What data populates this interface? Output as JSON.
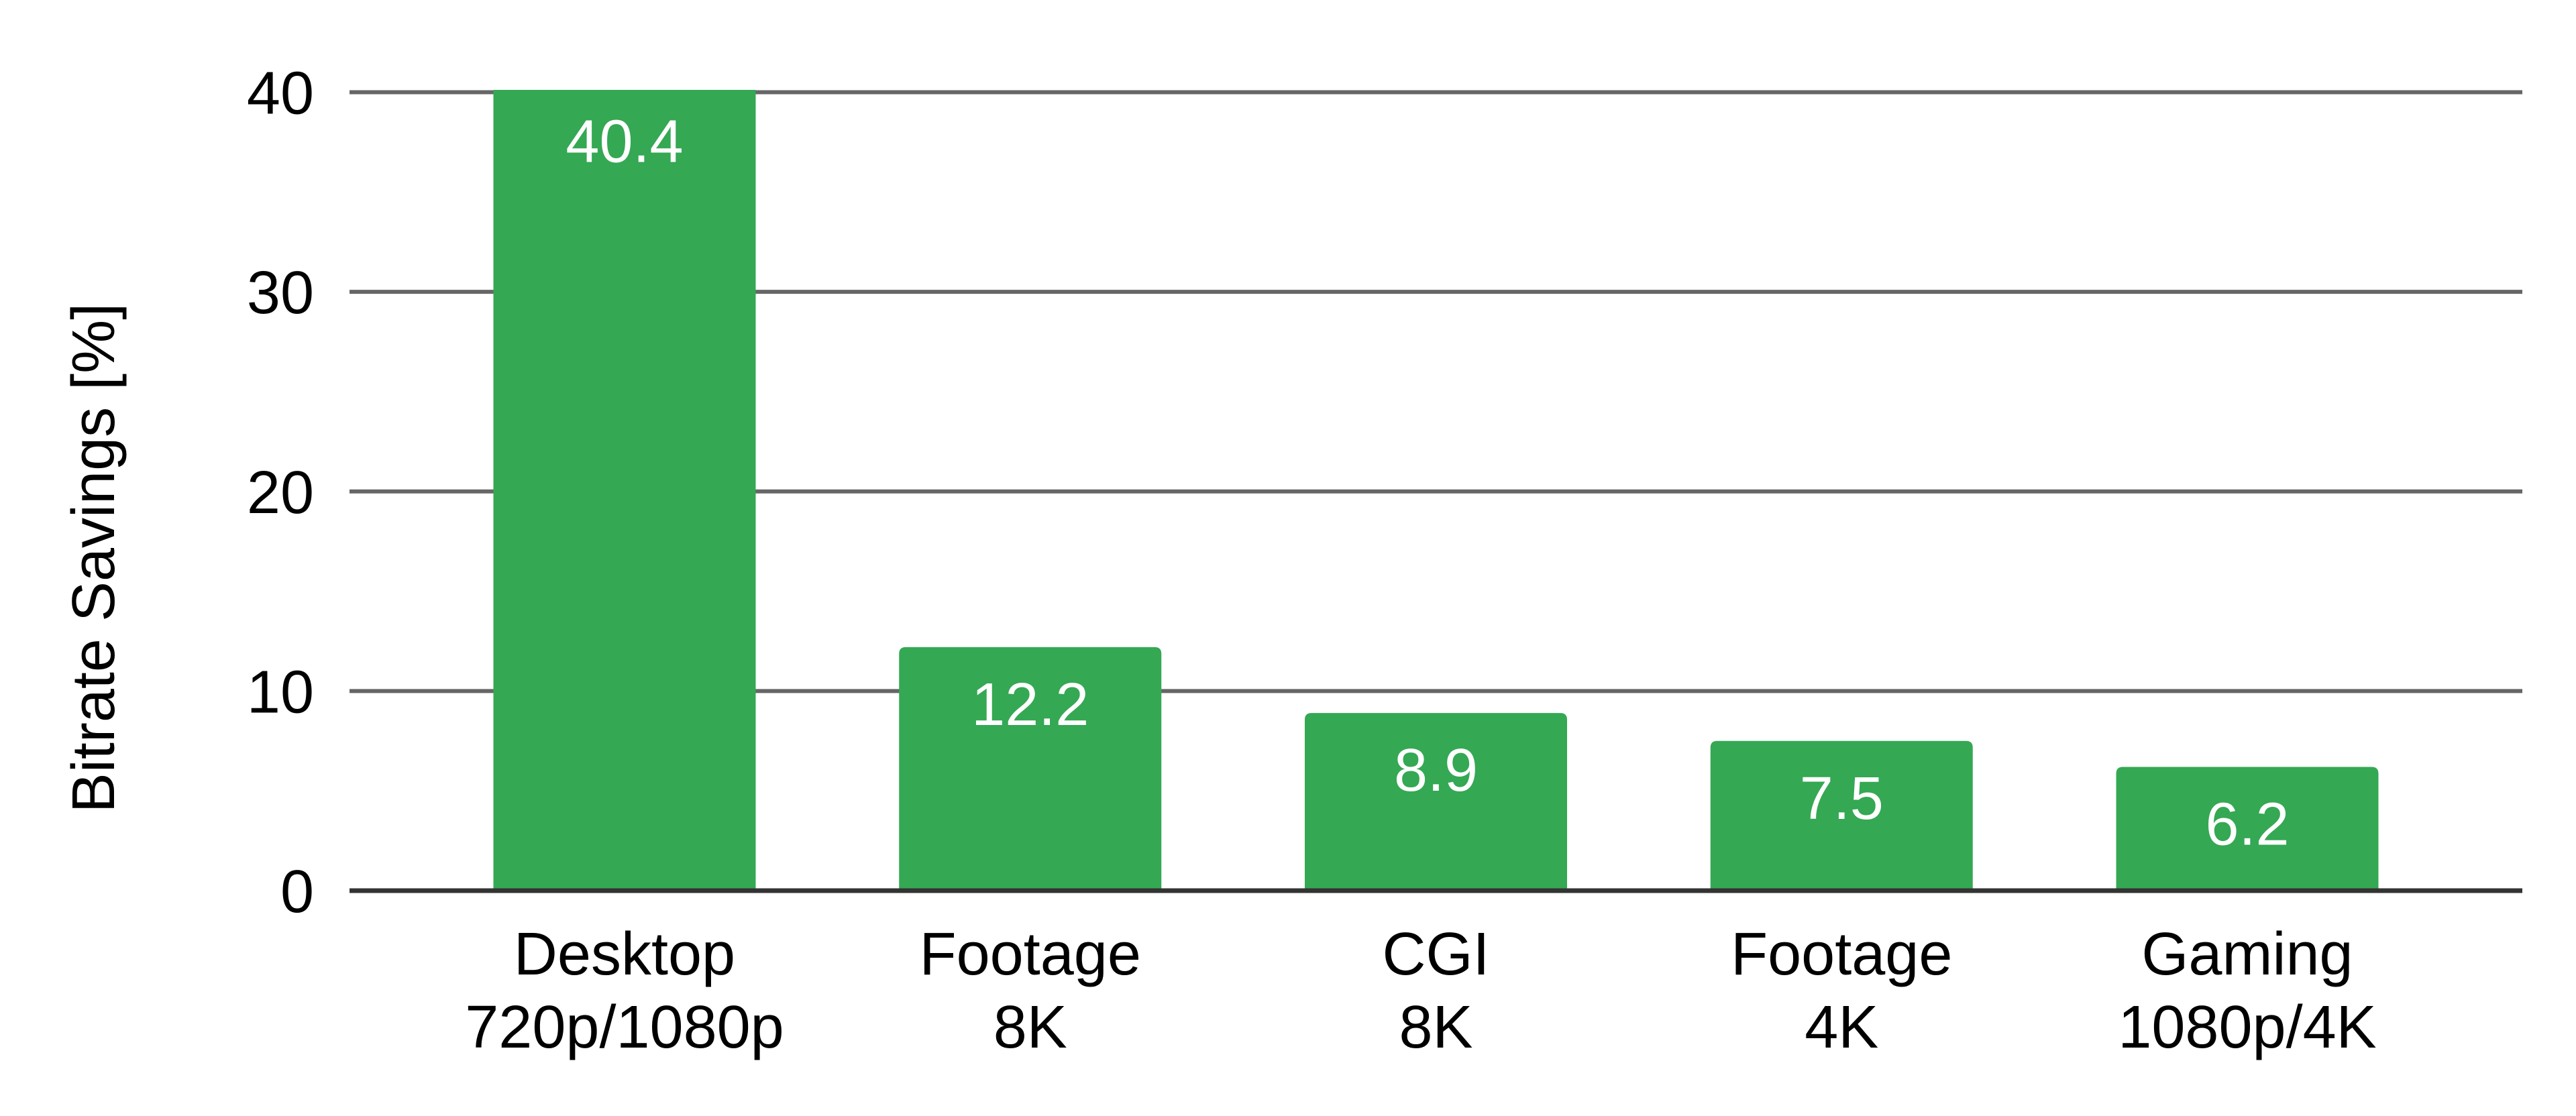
{
  "chart_data": {
    "type": "bar",
    "title": "",
    "xlabel": "",
    "ylabel": "Bitrate Savings [%]",
    "ylim": [
      0,
      40
    ],
    "yticks": [
      0,
      10,
      20,
      30,
      40
    ],
    "grid": true,
    "legend": "none",
    "categories": [
      [
        "Desktop",
        "720p/1080p"
      ],
      [
        "Footage",
        "8K"
      ],
      [
        "CGI",
        "8K"
      ],
      [
        "Footage",
        "4K"
      ],
      [
        "Gaming",
        "1080p/4K"
      ]
    ],
    "values": [
      40.4,
      12.2,
      8.9,
      7.5,
      6.2
    ],
    "data_labels": [
      "40.4",
      "12.2",
      "8.9",
      "7.5",
      "6.2"
    ],
    "colors": {
      "bar": "#34A853",
      "gridline": "#666666",
      "baseline": "#333333",
      "data_label": "#FFFFFF",
      "text": "#000000"
    }
  }
}
